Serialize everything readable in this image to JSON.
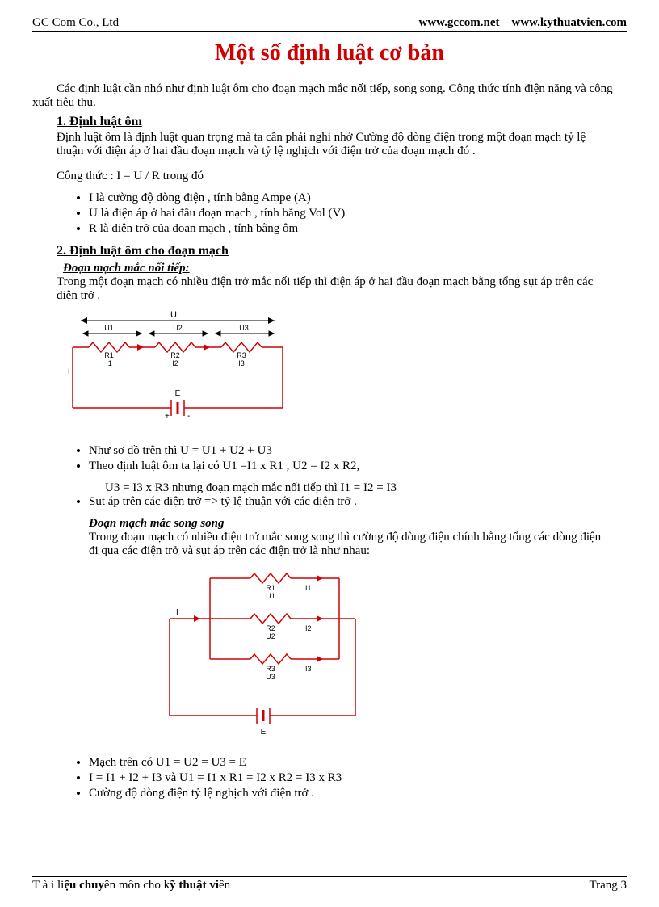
{
  "header": {
    "company": "GC Com Co., Ltd",
    "sites": "www.gccom.net – www.kythuatvien.com"
  },
  "title": "Một số định luật cơ bản",
  "intro": "Các định luật cần nhớ như định luật ôm cho đoạn mạch mắc nối tiếp, song song. Công thức tính điện năng và công xuất tiêu thụ.",
  "section1": {
    "heading": "1. Định  luật ôm",
    "text": "Định luật ôm là định luật quan trọng mà ta cần phải nghi nhớ    Cường độ dòng điện trong một đoạn mạch tỷ lệ thuận với điện áp ở hai đầu đoạn mạch và tỷ lệ nghịch với điện trở của đoạn mạch đó .",
    "formula": "Công thức :    I = U / R trong đó",
    "bullets": [
      " I là cường độ dòng điện , tính bằng Ampe (A)",
      "U là điện áp ở hai đầu đoạn mạch , tính bằng Vol (V)",
      "R là điện trở của đoạn mạch , tính bằng ôm"
    ]
  },
  "section2": {
    "heading": "2. Định luật ôm cho đoạn mạch",
    "sub1_heading": "Đoạn mạch mắc nối tiếp:",
    "sub1_text": " Trong một đoạn mạch có nhiều điện trở mắc nối tiếp thì điện áp ở hai đầu đoạn mạch bằng tổng sụt áp trên các điện trở .",
    "sub1_bullets": [
      " Như sơ đồ trên thì  U = U1 + U2 + U3",
      " Theo định luật ôm ta lại có U1 =I1 x R1 , U2 = I2 x R2,"
    ],
    "sub1_indent": "U3 = I3 x R3  nhưng đoạn mạch mắc nối tiếp thì  I1 = I2 = I3",
    "sub1_bullet3": "Sụt áp trên các điện trở =>  tỷ lệ thuận với các điện trở .",
    "sub2_heading": "Đoạn mạch mắc song song",
    "sub2_text": " Trong đoạn mạch có nhiều điện trở mắc song song thì cường độ dòng điện chính bằng tổng các dòng điện đi qua các điện trở và sụt áp trên các điện trở là như nhau:",
    "sub2_bullets": [
      "Mạch trên có U1 = U2 = U3 = E",
      "I  = I1 + I2 + I3 và U1 = I1 x R1  = I2 x R2 = I3 x R3",
      "Cường độ dòng điện tỷ lệ nghịch với điện trở ."
    ]
  },
  "diagram1": {
    "U": "U",
    "U1": "U1",
    "U2": "U2",
    "U3": "U3",
    "R1": "R1",
    "R2": "R2",
    "R3": "R3",
    "I1": "I1",
    "I2": "I2",
    "I3": "I3",
    "I": "I",
    "E": "E",
    "plus": "+",
    "minus": "-"
  },
  "diagram2": {
    "R1": "R1",
    "R2": "R2",
    "R3": "R3",
    "U1": "U1",
    "U2": "U2",
    "U3": "U3",
    "I1": "I1",
    "I2": "I2",
    "I3": "I3",
    "I": "I",
    "E": "E"
  },
  "footer": {
    "left_plain1": "T à i li",
    "left_bold1": "ệu chuy",
    "left_plain2": "ên môn cho k",
    "left_bold2": "ỹ thuật vi",
    "left_plain3": "ên",
    "page": "Trang 3"
  }
}
